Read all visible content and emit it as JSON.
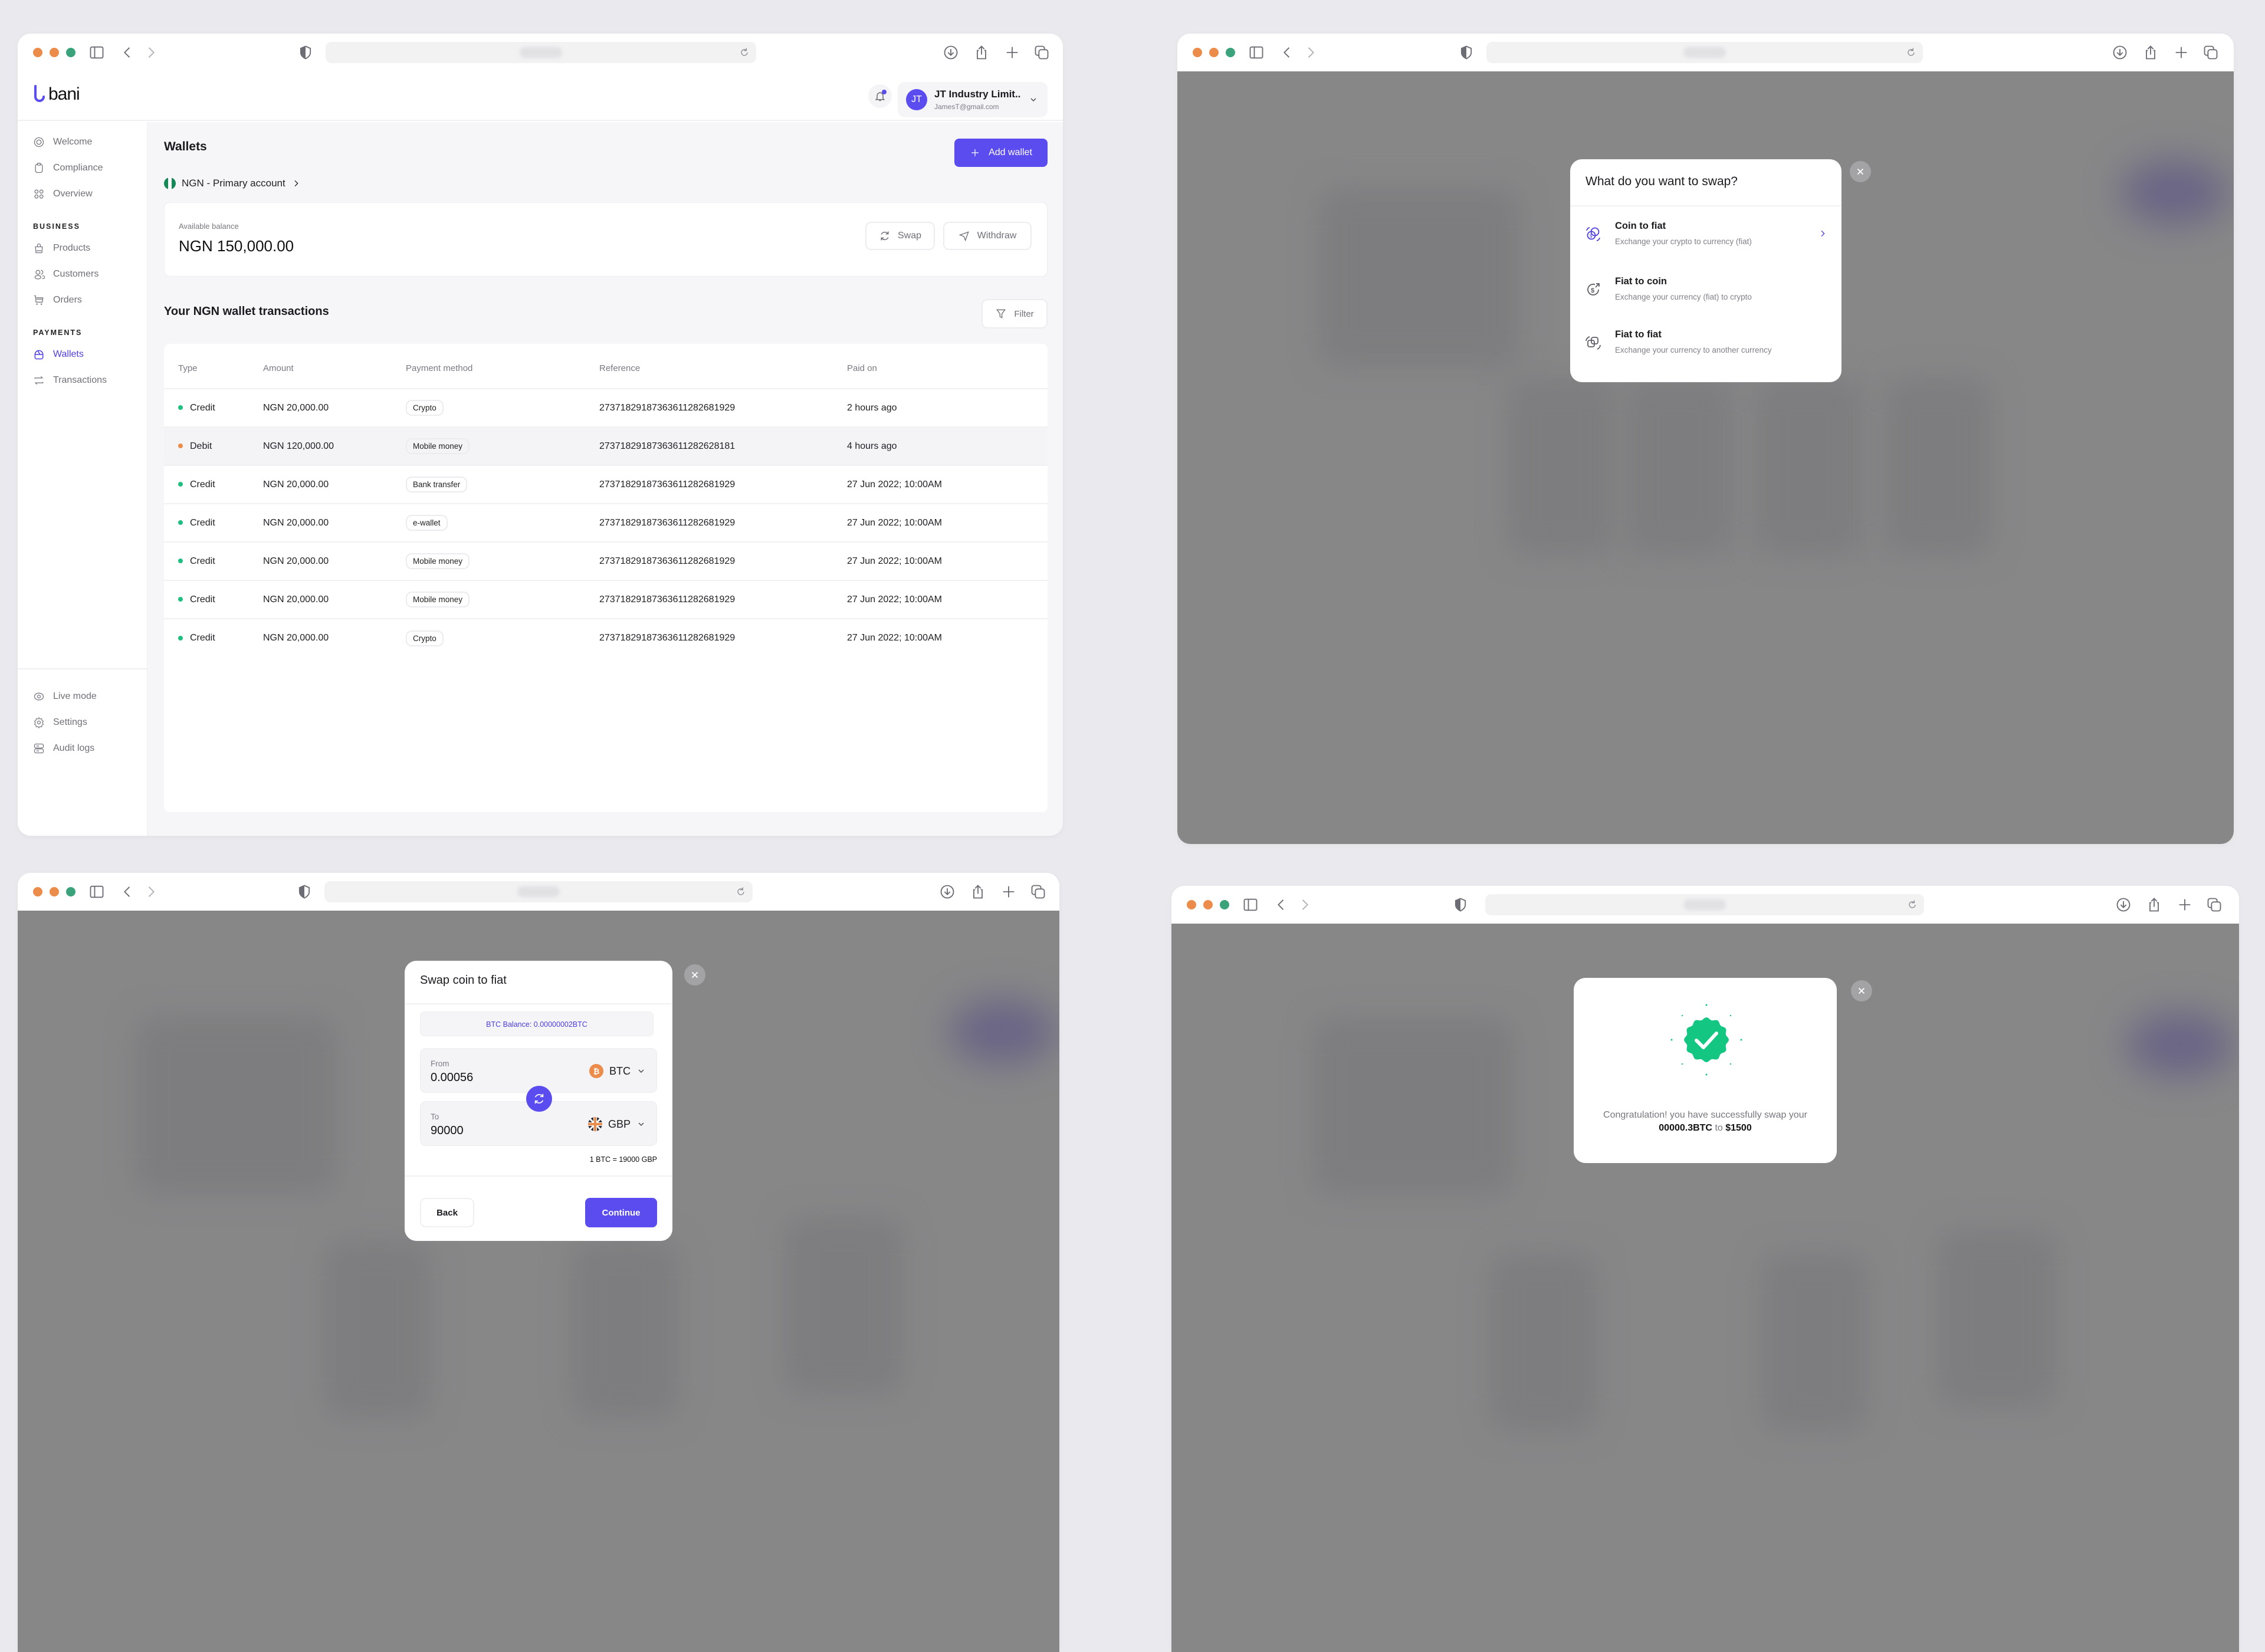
{
  "browser": {
    "url_placeholder": "blurred"
  },
  "app": {
    "brand": "bani",
    "accent_color": "#5b4cf0",
    "account": {
      "initials": "JT",
      "name": "JT Industry Limit..",
      "email": "JamesT@gmail.com"
    }
  },
  "sidebar": {
    "top_items": [
      {
        "label": "Welcome",
        "icon": "welcome-icon"
      },
      {
        "label": "Compliance",
        "icon": "clipboard-icon"
      },
      {
        "label": "Overview",
        "icon": "grid-icon"
      }
    ],
    "sections": [
      {
        "title": "BUSINESS",
        "items": [
          {
            "label": "Products",
            "icon": "bag-icon"
          },
          {
            "label": "Customers",
            "icon": "users-icon"
          },
          {
            "label": "Orders",
            "icon": "cart-icon"
          }
        ]
      },
      {
        "title": "PAYMENTS",
        "items": [
          {
            "label": "Wallets",
            "icon": "wallet-icon",
            "active": true
          },
          {
            "label": "Transactions",
            "icon": "transfer-icon"
          }
        ]
      }
    ],
    "bottom_items": [
      {
        "label": "Live mode",
        "icon": "eye-icon"
      },
      {
        "label": "Settings",
        "icon": "gear-icon"
      },
      {
        "label": "Audit logs",
        "icon": "server-icon"
      }
    ]
  },
  "wallets": {
    "title": "Wallets",
    "add_wallet_label": "Add wallet",
    "account_selector": "NGN - Primary account",
    "available_balance_label": "Available balance",
    "available_balance": "NGN 150,000.00",
    "swap_label": "Swap",
    "withdraw_label": "Withdraw",
    "transactions_title": "Your NGN wallet transactions",
    "filter_label": "Filter",
    "table": {
      "columns": [
        "Type",
        "Amount",
        "Payment method",
        "Reference",
        "Paid on"
      ],
      "rows": [
        {
          "type": "Credit",
          "status_color": "#1fbf7f",
          "amount": "NGN 20,000.00",
          "method": "Crypto",
          "reference": "27371829187363611282681929",
          "paid_on": "2 hours ago"
        },
        {
          "type": "Debit",
          "status_color": "#ec8c4b",
          "amount": "NGN 120,000.00",
          "method": "Mobile money",
          "reference": "27371829187363611282628181",
          "paid_on": "4 hours ago",
          "highlighted": true
        },
        {
          "type": "Credit",
          "status_color": "#1fbf7f",
          "amount": "NGN 20,000.00",
          "method": "Bank transfer",
          "reference": "27371829187363611282681929",
          "paid_on": "27 Jun 2022; 10:00AM"
        },
        {
          "type": "Credit",
          "status_color": "#1fbf7f",
          "amount": "NGN 20,000.00",
          "method": "e-wallet",
          "reference": "27371829187363611282681929",
          "paid_on": "27 Jun 2022; 10:00AM"
        },
        {
          "type": "Credit",
          "status_color": "#1fbf7f",
          "amount": "NGN 20,000.00",
          "method": "Mobile money",
          "reference": "27371829187363611282681929",
          "paid_on": "27 Jun 2022; 10:00AM"
        },
        {
          "type": "Credit",
          "status_color": "#1fbf7f",
          "amount": "NGN 20,000.00",
          "method": "Mobile money",
          "reference": "27371829187363611282681929",
          "paid_on": "27 Jun 2022; 10:00AM"
        },
        {
          "type": "Credit",
          "status_color": "#1fbf7f",
          "amount": "NGN 20,000.00",
          "method": "Crypto",
          "reference": "27371829187363611282681929",
          "paid_on": "27 Jun 2022; 10:00AM"
        }
      ]
    }
  },
  "swap_choice_modal": {
    "title": "What do you want to swap?",
    "options": [
      {
        "title": "Coin to fiat",
        "description": "Exchange your crypto to currency (fiat)",
        "icon": "coin-exchange-icon",
        "selected": true
      },
      {
        "title": "Fiat to coin",
        "description": "Exchange your currency (fiat) to crypto",
        "icon": "dollar-arrow-icon"
      },
      {
        "title": "Fiat to fiat",
        "description": "Exchange your currency to another currency",
        "icon": "currency-swap-icon"
      }
    ]
  },
  "swap_coin_modal": {
    "title": "Swap coin to fiat",
    "balance_banner": "BTC Balance: 0.00000002BTC",
    "from_label": "From",
    "from_value": "0.00056",
    "from_currency": "BTC",
    "to_label": "To",
    "to_value": "90000",
    "to_currency": "GBP",
    "rate": "1 BTC  = 19000 GBP",
    "back_label": "Back",
    "continue_label": "Continue"
  },
  "success_modal": {
    "message_prefix": "Congratulation! you have successfully swap your",
    "amount_from": "00000.3BTC",
    "connector": "to",
    "amount_to": "$1500",
    "badge_color": "#13c783"
  }
}
